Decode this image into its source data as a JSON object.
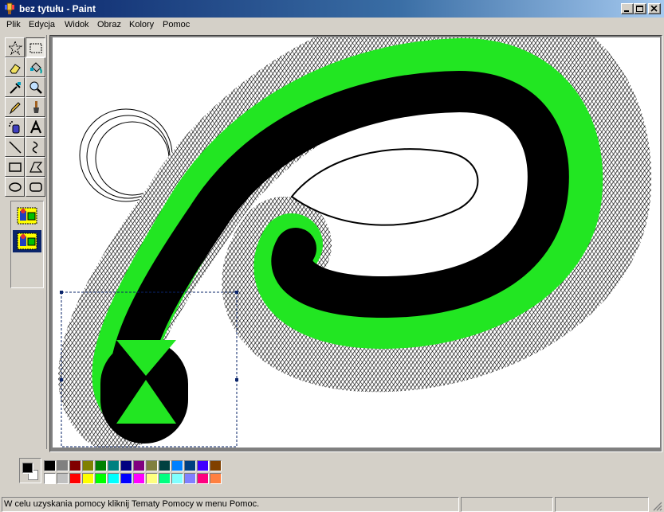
{
  "window": {
    "title": "bez tytułu - Paint"
  },
  "menu": [
    "Plik",
    "Edycja",
    "Widok",
    "Obraz",
    "Kolory",
    "Pomoc"
  ],
  "tools": [
    {
      "name": "free-form-select-tool",
      "icon": "star-select-icon"
    },
    {
      "name": "rectangle-select-tool",
      "icon": "rect-select-icon"
    },
    {
      "name": "eraser-tool",
      "icon": "eraser-icon"
    },
    {
      "name": "fill-tool",
      "icon": "bucket-icon"
    },
    {
      "name": "pick-color-tool",
      "icon": "eyedropper-icon"
    },
    {
      "name": "magnifier-tool",
      "icon": "magnifier-icon"
    },
    {
      "name": "pencil-tool",
      "icon": "pencil-icon"
    },
    {
      "name": "brush-tool",
      "icon": "brush-icon"
    },
    {
      "name": "airbrush-tool",
      "icon": "airbrush-icon"
    },
    {
      "name": "text-tool",
      "icon": "text-icon"
    },
    {
      "name": "line-tool",
      "icon": "line-icon"
    },
    {
      "name": "curve-tool",
      "icon": "curve-icon"
    },
    {
      "name": "rectangle-tool",
      "icon": "rectangle-icon"
    },
    {
      "name": "polygon-tool",
      "icon": "polygon-icon"
    },
    {
      "name": "ellipse-tool",
      "icon": "ellipse-icon"
    },
    {
      "name": "rounded-rectangle-tool",
      "icon": "rounded-rect-icon"
    }
  ],
  "active_tool": "rectangle-select-tool",
  "colors": {
    "foreground": "#000000",
    "background": "#ffffff",
    "palette_top": [
      "#000000",
      "#808080",
      "#800000",
      "#808000",
      "#008000",
      "#008080",
      "#000080",
      "#800080",
      "#808040",
      "#004040",
      "#0080ff",
      "#004080",
      "#4000ff",
      "#804000"
    ],
    "palette_bottom": [
      "#ffffff",
      "#c0c0c0",
      "#ff0000",
      "#ffff00",
      "#00ff00",
      "#00ffff",
      "#0000ff",
      "#ff00ff",
      "#ffff80",
      "#00ff80",
      "#80ffff",
      "#8080ff",
      "#ff0080",
      "#ff8040"
    ]
  },
  "status": {
    "help_text": "W celu uzyskania pomocy kliknij Tematy Pomocy w menu Pomoc."
  }
}
